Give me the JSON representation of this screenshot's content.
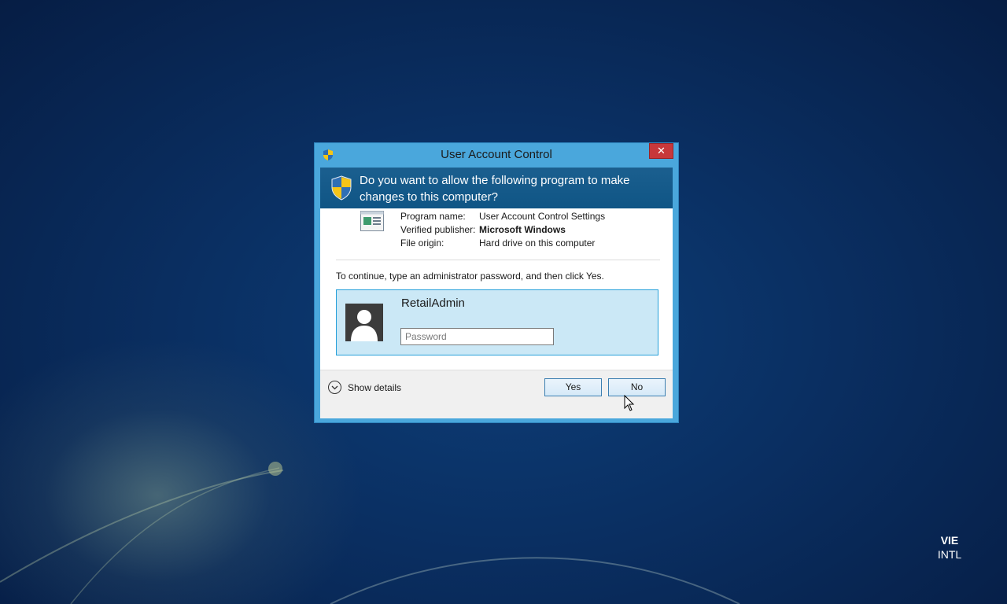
{
  "window": {
    "title": "User Account Control",
    "close_label": "✕"
  },
  "banner": {
    "question": "Do you want to allow the following program to make changes to this computer?"
  },
  "program_info": {
    "rows": [
      {
        "label": "Program name:",
        "value": "User Account Control Settings"
      },
      {
        "label": "Verified publisher:",
        "value": "Microsoft Windows"
      },
      {
        "label": "File origin:",
        "value": "Hard drive on this computer"
      }
    ]
  },
  "instruction": "To continue, type an administrator password, and then click Yes.",
  "credential": {
    "username": "RetailAdmin",
    "password_value": "",
    "password_placeholder": "Password"
  },
  "footer": {
    "show_details_label": "Show details",
    "yes_label": "Yes",
    "no_label": "No"
  },
  "language": {
    "code": "VIE",
    "layout": "INTL"
  },
  "colors": {
    "window_frame": "#4aa7dc",
    "banner": "#1b5f8f",
    "credential_tile": "#cbe8f6",
    "close_button": "#c7383b"
  },
  "icons": {
    "title": "uac-shield-icon",
    "banner": "uac-shield-icon",
    "program": "program-window-icon",
    "avatar": "user-avatar-icon",
    "details": "chevron-down-icon",
    "pointer": "mouse-cursor-icon"
  }
}
